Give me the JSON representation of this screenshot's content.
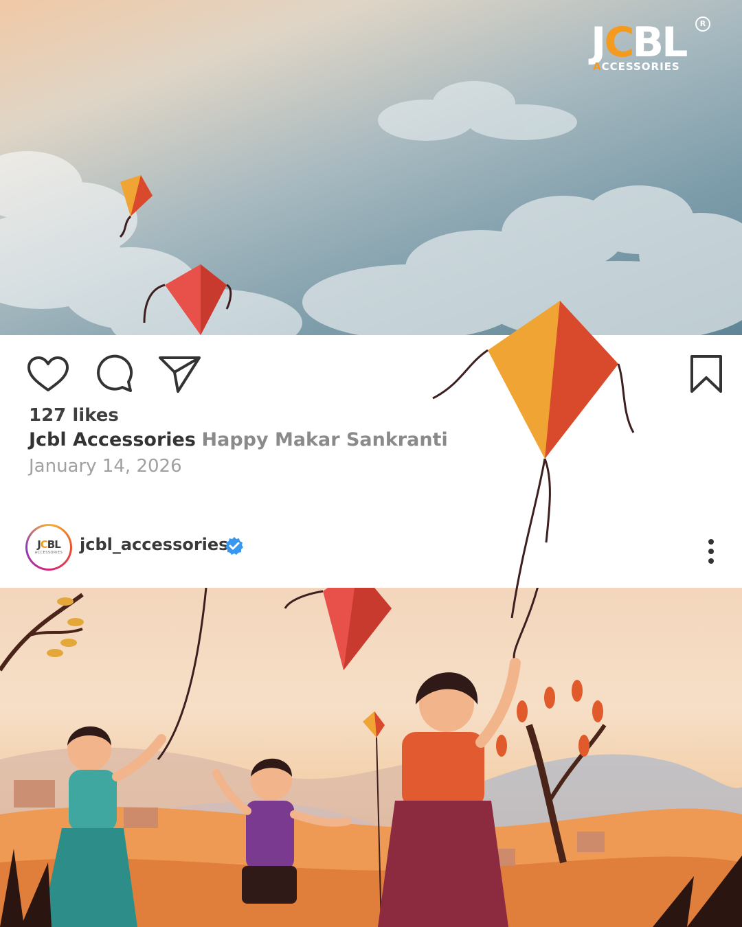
{
  "brand": {
    "logo_main": "JCBL",
    "logo_sub": "ACCESSORIES",
    "logo_reg": "R",
    "accent_color": "#f39a1f"
  },
  "post": {
    "likes_text": "127 likes",
    "author": "Jcbl Accessories",
    "caption": "Happy Makar Sankranti",
    "date": "January 14, 2026"
  },
  "account": {
    "username": "jcbl_accessories",
    "avatar_main": "JCBL",
    "avatar_sub": "ACCESSORIES",
    "verified": true,
    "verified_color": "#3897f0"
  },
  "actions": {
    "like_icon": "heart-icon",
    "comment_icon": "comment-icon",
    "share_icon": "send-icon",
    "save_icon": "bookmark-icon",
    "more_icon": "more-vertical-icon"
  }
}
